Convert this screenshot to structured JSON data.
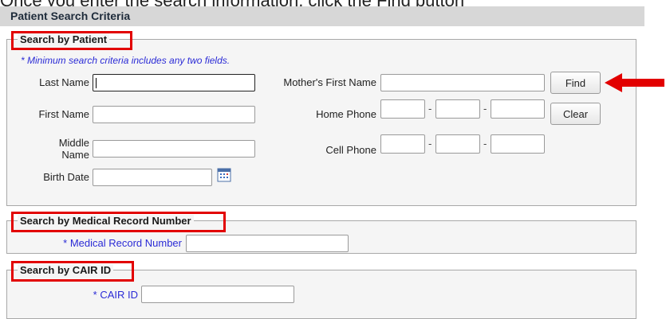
{
  "caption": "Once you enter the search information, click the Find button",
  "header": {
    "title": "Patient Search Criteria"
  },
  "section_patient": {
    "legend": "Search by Patient",
    "note": "* Minimum search criteria includes any two fields.",
    "last_name_label": "Last Name",
    "first_name_label": "First Name",
    "middle_name_label_1": "Middle",
    "middle_name_label_2": "Name",
    "birth_date_label": "Birth Date",
    "mothers_first_name_label": "Mother's First Name",
    "home_phone_label": "Home Phone",
    "cell_phone_label": "Cell Phone",
    "phone_separator": "-",
    "find_label": "Find",
    "clear_label": "Clear"
  },
  "section_mrn": {
    "legend": "Search by Medical Record Number",
    "field_label": "* Medical Record Number"
  },
  "section_cair": {
    "legend": "Search by CAIR ID",
    "field_label": "* CAIR ID"
  },
  "colors": {
    "highlight": "#e20000",
    "required_label": "#2b2bd6",
    "header_bg": "#d7d7d7",
    "panel_bg": "#f5f5f5"
  },
  "icons": [
    "calendar-icon",
    "red-arrow-icon"
  ]
}
